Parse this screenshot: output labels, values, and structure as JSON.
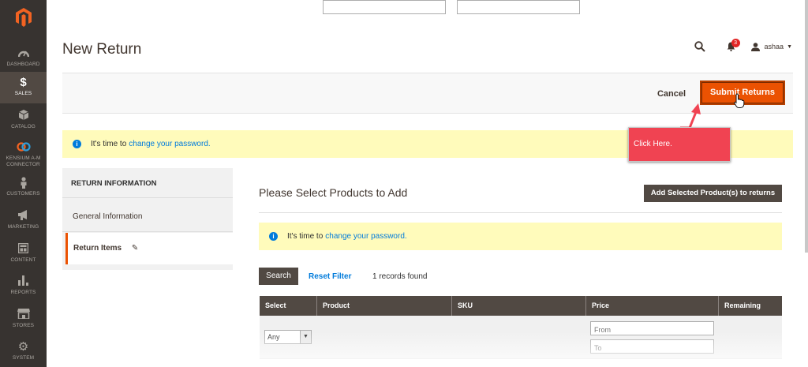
{
  "sidebar": {
    "items": [
      {
        "label": "DASHBOARD",
        "icon": "dashboard-icon"
      },
      {
        "label": "SALES",
        "icon": "dollar-icon"
      },
      {
        "label": "CATALOG",
        "icon": "cube-icon"
      },
      {
        "label": "KENSIUM A-M CONNECTOR",
        "icon": "connector-icon"
      },
      {
        "label": "CUSTOMERS",
        "icon": "person-icon"
      },
      {
        "label": "MARKETING",
        "icon": "megaphone-icon"
      },
      {
        "label": "CONTENT",
        "icon": "layout-icon"
      },
      {
        "label": "REPORTS",
        "icon": "bar-chart-icon"
      },
      {
        "label": "STORES",
        "icon": "store-icon"
      },
      {
        "label": "SYSTEM",
        "icon": "gear-icon"
      }
    ],
    "active": "SALES"
  },
  "header": {
    "title": "New Return",
    "notification_count": "3",
    "username": "ashaa"
  },
  "actions": {
    "cancel_label": "Cancel",
    "submit_label": "Submit Returns"
  },
  "notice": {
    "text": "It's time to",
    "link": "change your password."
  },
  "callout": {
    "text": "Click Here."
  },
  "tabs": {
    "title": "RETURN INFORMATION",
    "general": "General Information",
    "return_items": "Return Items"
  },
  "main": {
    "section_title": "Please Select Products to Add",
    "add_button": "Add Selected Product(s) to returns",
    "search_button": "Search",
    "reset_link": "Reset Filter",
    "records": "1 records found"
  },
  "grid": {
    "columns": [
      "Select",
      "Product",
      "SKU",
      "Price",
      "Remaining"
    ],
    "select_value": "Any",
    "price_from_placeholder": "From",
    "price_to_placeholder": "To"
  },
  "colors": {
    "sidebar": "#373330",
    "accent": "#eb5202",
    "link": "#007bdb",
    "callout": "#f04352"
  }
}
